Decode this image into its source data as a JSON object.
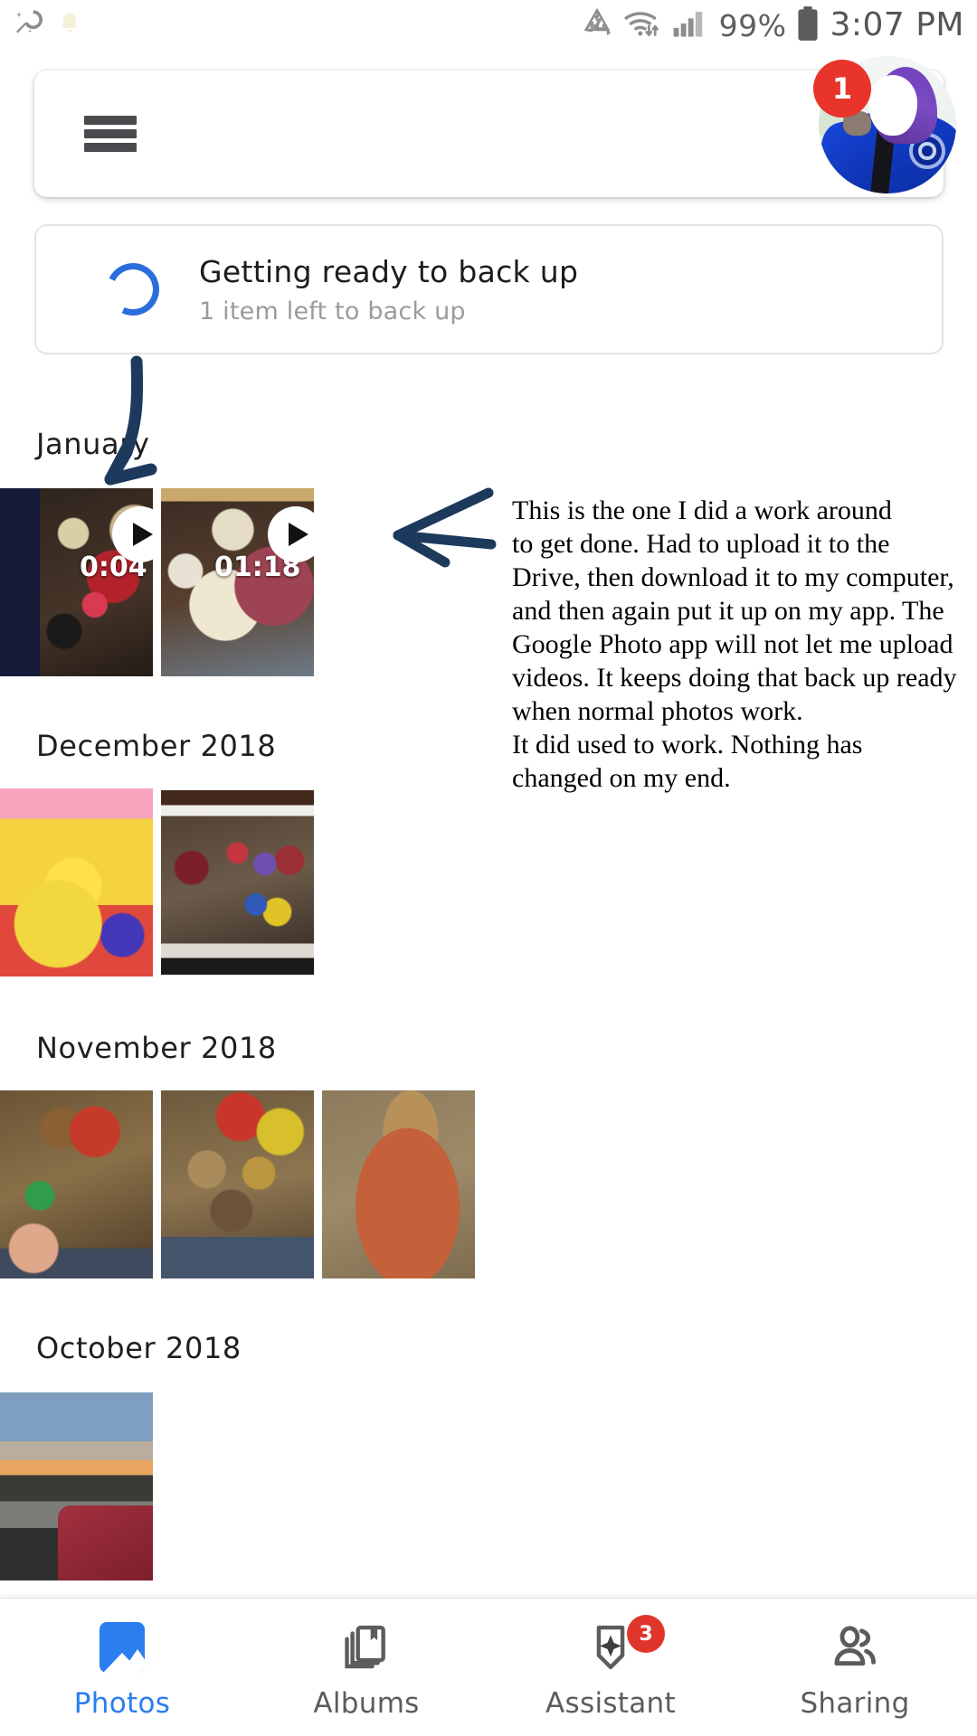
{
  "status_bar": {
    "left_icons": [
      "magic-wand-icon",
      "bell-icon"
    ],
    "right_icons": [
      "data-saver-icon",
      "wifi-icon",
      "cellular-signal-icon",
      "battery-icon"
    ],
    "battery_percent": "99%",
    "time": "3:07 PM"
  },
  "header": {
    "menu_icon": "hamburger-menu-icon",
    "search_placeholder": "",
    "avatar_badge_count": "1"
  },
  "backup_card": {
    "title": "Getting ready to back up",
    "subtitle": "1 item left to back up",
    "spinner_color": "#2a6ede"
  },
  "sections": [
    {
      "label": "January",
      "items": [
        {
          "name": "video-thumbnail-toy-shelf",
          "type": "video",
          "duration": "0:04"
        },
        {
          "name": "video-thumbnail-dog-and-person",
          "type": "video",
          "duration": "01:18"
        }
      ]
    },
    {
      "label": "December 2018",
      "items": [
        {
          "name": "photo-thumbnail-sailor-moon-figure",
          "type": "photo",
          "duration": ""
        },
        {
          "name": "photo-thumbnail-figure-display-shelf",
          "type": "photo",
          "duration": ""
        }
      ]
    },
    {
      "label": "November 2018",
      "items": [
        {
          "name": "photo-thumbnail-display-case-one",
          "type": "photo",
          "duration": ""
        },
        {
          "name": "photo-thumbnail-display-case-two",
          "type": "photo",
          "duration": ""
        },
        {
          "name": "photo-thumbnail-squirrel-plush",
          "type": "photo",
          "duration": ""
        }
      ]
    },
    {
      "label": "October 2018",
      "items": [
        {
          "name": "photo-thumbnail-sunset-street",
          "type": "photo",
          "duration": ""
        }
      ]
    }
  ],
  "annotations": {
    "arrow_color": "#1d3a5c",
    "note_lines": [
      "This is the one I did a work around",
      "to get done. Had to upload it to the",
      "Drive, then download it to my computer,",
      "and then again put it up on my app. The",
      "Google Photo app will not let me upload",
      "videos. It keeps doing that back up ready",
      "when normal photos work.",
      "It did used to work. Nothing has",
      "changed on my end."
    ]
  },
  "bottom_nav": {
    "items": [
      {
        "label": "Photos",
        "icon": "photos-icon",
        "active": true,
        "badge": ""
      },
      {
        "label": "Albums",
        "icon": "albums-icon",
        "active": false,
        "badge": ""
      },
      {
        "label": "Assistant",
        "icon": "assistant-icon",
        "active": false,
        "badge": "3"
      },
      {
        "label": "Sharing",
        "icon": "sharing-icon",
        "active": false,
        "badge": ""
      }
    ]
  }
}
